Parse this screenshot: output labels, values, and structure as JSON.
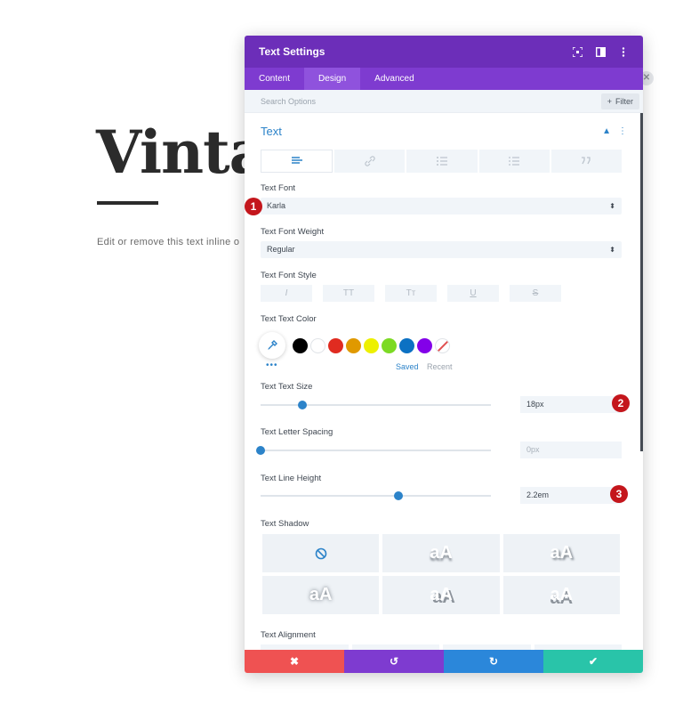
{
  "background": {
    "heading": "Vintag",
    "body_text": "Edit or remove this text inline o"
  },
  "modal": {
    "title": "Text Settings",
    "tabs": [
      {
        "label": "Content",
        "active": false
      },
      {
        "label": "Design",
        "active": true
      },
      {
        "label": "Advanced",
        "active": false
      }
    ],
    "search": {
      "placeholder": "Search Options"
    },
    "filter_label": "Filter",
    "section_title": "Text",
    "fields": {
      "text_font": {
        "label": "Text Font",
        "value": "Karla"
      },
      "font_weight": {
        "label": "Text Font Weight",
        "value": "Regular"
      },
      "font_style": {
        "label": "Text Font Style",
        "buttons": [
          "I",
          "TT",
          "Tт",
          "U",
          "S"
        ]
      },
      "text_color": {
        "label": "Text Text Color",
        "swatches": [
          "#000000",
          "#ffffff",
          "#e02b20",
          "#e09900",
          "#edf000",
          "#7cda24",
          "#0c71c3",
          "#8300e9"
        ],
        "saved_label": "Saved",
        "recent_label": "Recent"
      },
      "text_size": {
        "label": "Text Text Size",
        "value": "18px",
        "slider_fraction": 0.18
      },
      "letter_spacing": {
        "label": "Text Letter Spacing",
        "value": "0px",
        "slider_fraction": 0.0
      },
      "line_height": {
        "label": "Text Line Height",
        "value": "2.2em",
        "slider_fraction": 0.6
      },
      "text_shadow": {
        "label": "Text Shadow",
        "preview_text": "aA"
      },
      "text_alignment": {
        "label": "Text Alignment"
      }
    },
    "footer": {
      "cancel": "✖",
      "undo": "↺",
      "redo": "↻",
      "save": "✔"
    }
  },
  "markers": [
    "1",
    "2",
    "3"
  ],
  "colors": {
    "header": "#6c2eb9",
    "tabs": "#7e3bd0",
    "accent": "#2c83c9",
    "cancel": "#ef5252",
    "redo": "#2b87da",
    "save": "#29c4a9",
    "marker": "#c4161c"
  }
}
